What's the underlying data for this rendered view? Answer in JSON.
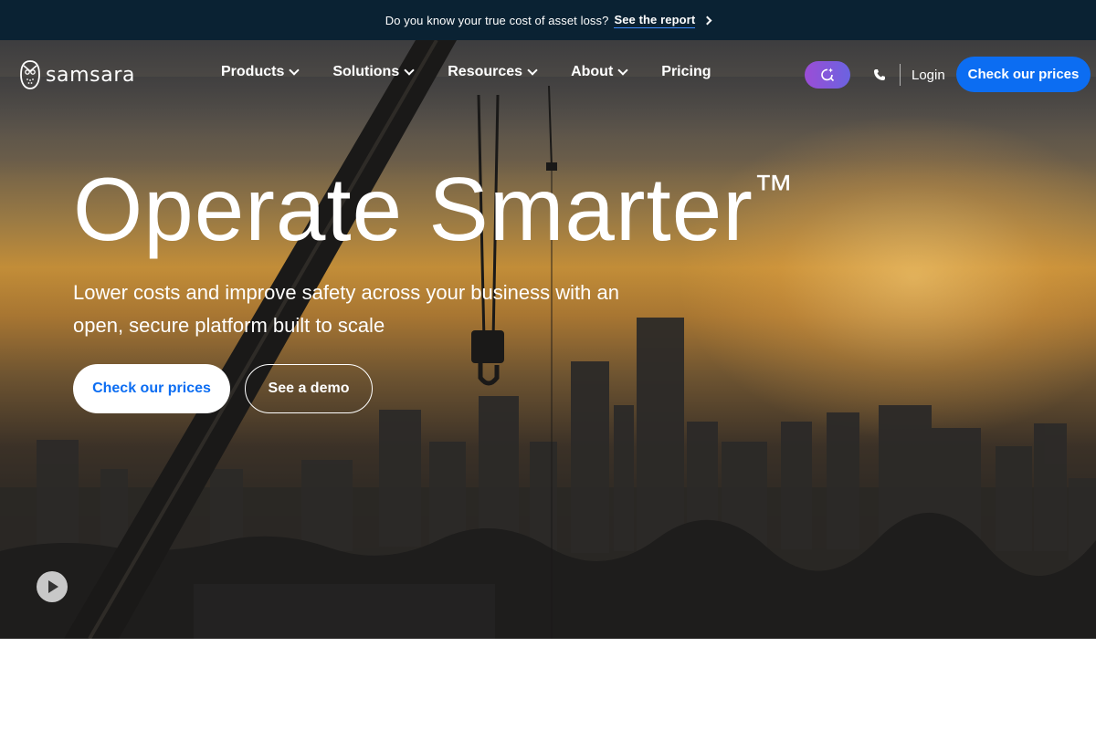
{
  "announcement": {
    "text": "Do you know your true cost of asset loss?",
    "link_label": "See the report"
  },
  "nav": {
    "logo_text": "samsara",
    "menu": [
      {
        "label": "Products",
        "has_dropdown": true
      },
      {
        "label": "Solutions",
        "has_dropdown": true
      },
      {
        "label": "Resources",
        "has_dropdown": true
      },
      {
        "label": "About",
        "has_dropdown": true
      },
      {
        "label": "Pricing",
        "has_dropdown": false
      }
    ],
    "ai_icon": "sparkle-search-icon",
    "phone_icon": "phone-icon",
    "login_label": "Login",
    "cta_label": "Check our prices"
  },
  "hero": {
    "headline": "Operate Smarter",
    "headline_mark": "™",
    "subhead": "Lower costs and improve safety across your business with an open, secure platform built to scale",
    "primary_cta": "Check our prices",
    "secondary_cta": "See a demo",
    "video_control_icon": "play-icon"
  },
  "colors": {
    "announcement_bg": "#0a2233",
    "brand_blue": "#0c6df2",
    "ai_gradient_start": "#9b4dd6",
    "ai_gradient_end": "#6b63e0"
  }
}
